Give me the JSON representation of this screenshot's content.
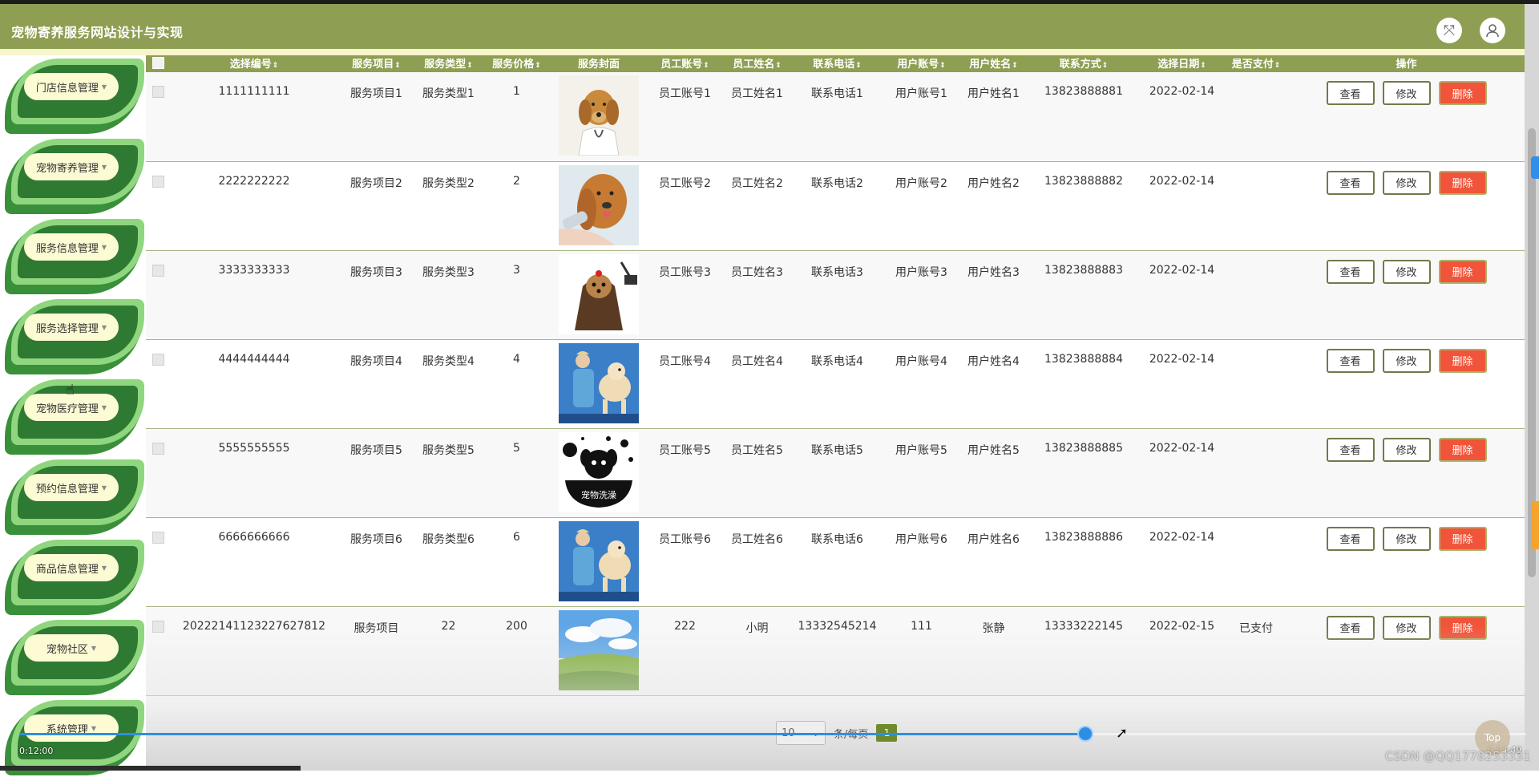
{
  "header": {
    "title": "宠物寄养服务网站设计与实现",
    "fullscreen_icon": "fullscreen-icon",
    "user_icon": "user-icon"
  },
  "sidebar": {
    "items": [
      {
        "label": "门店信息管理"
      },
      {
        "label": "宠物寄养管理"
      },
      {
        "label": "服务信息管理"
      },
      {
        "label": "服务选择管理"
      },
      {
        "label": "宠物医疗管理"
      },
      {
        "label": "预约信息管理"
      },
      {
        "label": "商品信息管理"
      },
      {
        "label": "宠物社区"
      },
      {
        "label": "系统管理"
      }
    ]
  },
  "table": {
    "columns": [
      "选择编号",
      "服务项目",
      "服务类型",
      "服务价格",
      "服务封面",
      "员工账号",
      "员工姓名",
      "联系电话",
      "用户账号",
      "用户姓名",
      "联系方式",
      "选择日期",
      "是否支付",
      "操作"
    ],
    "rows": [
      {
        "id": "1111111111",
        "item": "服务项目1",
        "type": "服务类型1",
        "price": "1",
        "emp_acc": "员工账号1",
        "emp_name": "员工姓名1",
        "phone": "联系电话1",
        "user_acc": "用户账号1",
        "user_name": "用户姓名1",
        "contact": "13823888881",
        "date": "2022-02-14",
        "paid": ""
      },
      {
        "id": "2222222222",
        "item": "服务项目2",
        "type": "服务类型2",
        "price": "2",
        "emp_acc": "员工账号2",
        "emp_name": "员工姓名2",
        "phone": "联系电话2",
        "user_acc": "用户账号2",
        "user_name": "用户姓名2",
        "contact": "13823888882",
        "date": "2022-02-14",
        "paid": ""
      },
      {
        "id": "3333333333",
        "item": "服务项目3",
        "type": "服务类型3",
        "price": "3",
        "emp_acc": "员工账号3",
        "emp_name": "员工姓名3",
        "phone": "联系电话3",
        "user_acc": "用户账号3",
        "user_name": "用户姓名3",
        "contact": "13823888883",
        "date": "2022-02-14",
        "paid": ""
      },
      {
        "id": "4444444444",
        "item": "服务项目4",
        "type": "服务类型4",
        "price": "4",
        "emp_acc": "员工账号4",
        "emp_name": "员工姓名4",
        "phone": "联系电话4",
        "user_acc": "用户账号4",
        "user_name": "用户姓名4",
        "contact": "13823888884",
        "date": "2022-02-14",
        "paid": ""
      },
      {
        "id": "5555555555",
        "item": "服务项目5",
        "type": "服务类型5",
        "price": "5",
        "emp_acc": "员工账号5",
        "emp_name": "员工姓名5",
        "phone": "联系电话5",
        "user_acc": "用户账号5",
        "user_name": "用户姓名5",
        "contact": "13823888885",
        "date": "2022-02-14",
        "paid": ""
      },
      {
        "id": "6666666666",
        "item": "服务项目6",
        "type": "服务类型6",
        "price": "6",
        "emp_acc": "员工账号6",
        "emp_name": "员工姓名6",
        "phone": "联系电话6",
        "user_acc": "用户账号6",
        "user_name": "用户姓名6",
        "contact": "13823888886",
        "date": "2022-02-14",
        "paid": ""
      },
      {
        "id": "20222141123227627812",
        "item": "服务项目",
        "type": "22",
        "price": "200",
        "emp_acc": "222",
        "emp_name": "小明",
        "phone": "13332545214",
        "user_acc": "111",
        "user_name": "张静",
        "contact": "13333222145",
        "date": "2022-02-15",
        "paid": "已支付"
      }
    ],
    "actions": {
      "view": "查看",
      "edit": "修改",
      "delete": "删除"
    }
  },
  "pager": {
    "page_size": "10",
    "per_page_label": "条/每页",
    "current_page": "1"
  },
  "video": {
    "elapsed": "0:12:00",
    "remaining": "0:04:49",
    "top_label": "Top"
  },
  "watermark": "CSDN @QQ1778253331",
  "colors": {
    "header": "#8e9e52",
    "delete": "#f0543a",
    "progress": "#2e8fe0"
  }
}
